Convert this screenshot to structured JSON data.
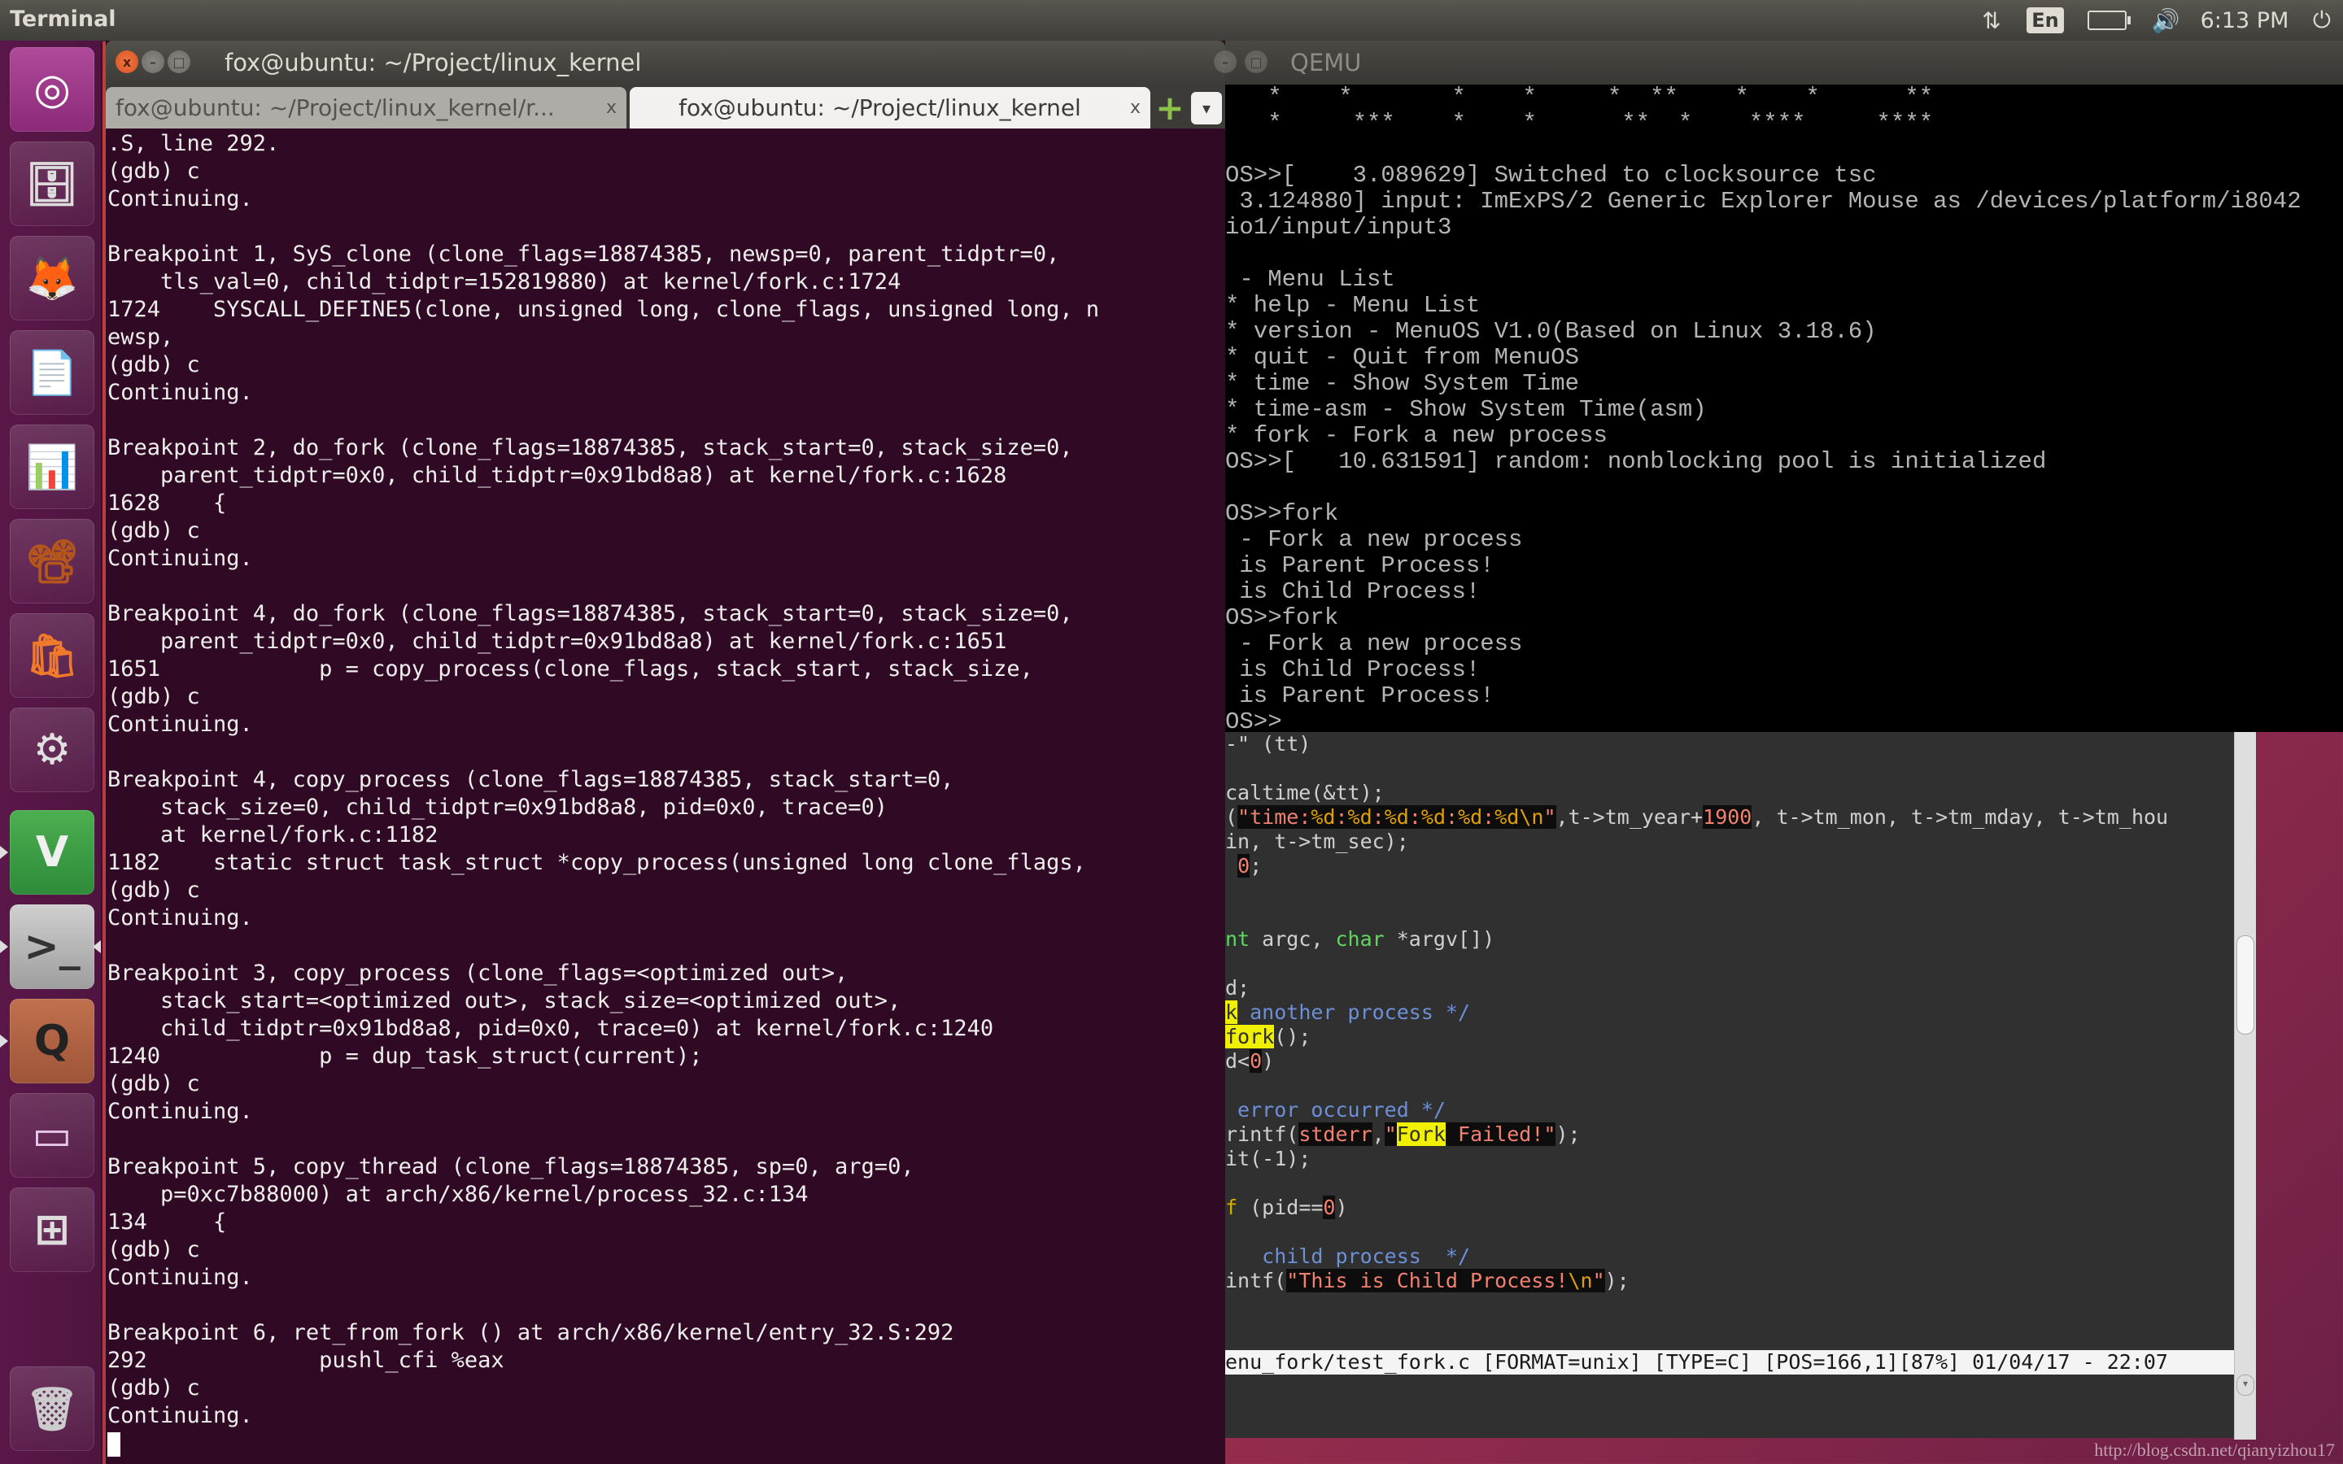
{
  "top_panel": {
    "app_title": "Terminal",
    "tray": {
      "network_icon": "network-transfer-icon",
      "keyboard_layout": "En",
      "battery_icon": "battery-charging-icon",
      "volume_icon": "volume-icon",
      "clock": "6:13 PM",
      "power_icon": "power-gear-icon"
    }
  },
  "launcher": {
    "items": [
      {
        "name": "dash-home",
        "icon": "ubuntu-logo-icon",
        "glyph": "◎"
      },
      {
        "name": "files",
        "icon": "file-cabinet-icon",
        "glyph": "🗄"
      },
      {
        "name": "firefox",
        "icon": "firefox-icon",
        "glyph": "🦊"
      },
      {
        "name": "libreoffice-writer",
        "icon": "writer-document-icon",
        "glyph": "📄"
      },
      {
        "name": "libreoffice-calc",
        "icon": "calc-spreadsheet-icon",
        "glyph": "📊"
      },
      {
        "name": "libreoffice-impress",
        "icon": "impress-presentation-icon",
        "glyph": "📽"
      },
      {
        "name": "software-center",
        "icon": "shopping-bag-icon",
        "glyph": "🛍"
      },
      {
        "name": "system-settings",
        "icon": "settings-wrench-icon",
        "glyph": "⚙"
      },
      {
        "name": "vim",
        "icon": "vim-icon",
        "glyph": "V"
      },
      {
        "name": "terminal",
        "icon": "terminal-icon",
        "glyph": ">_"
      },
      {
        "name": "qemu",
        "icon": "qemu-icon",
        "glyph": "Q"
      },
      {
        "name": "app-window",
        "icon": "window-icon",
        "glyph": "▭"
      },
      {
        "name": "workspace-switcher",
        "icon": "workspace-switcher-icon",
        "glyph": "⊞"
      },
      {
        "name": "trash",
        "icon": "trash-icon",
        "glyph": "🗑"
      }
    ]
  },
  "terminal": {
    "window_title": "fox@ubuntu: ~/Project/linux_kernel",
    "close_glyph": "x",
    "minimize_glyph": "–",
    "maximize_glyph": "□",
    "tabs": [
      {
        "label": "fox@ubuntu: ~/Project/linux_kernel/r...",
        "close": "x",
        "active": false
      },
      {
        "label": "fox@ubuntu: ~/Project/linux_kernel",
        "close": "x",
        "active": true
      }
    ],
    "new_tab_glyph": "+",
    "tab_menu_glyph": "▾",
    "lines": [
      ".S, line 292.",
      "(gdb) c",
      "Continuing.",
      "",
      "Breakpoint 1, SyS_clone (clone_flags=18874385, newsp=0, parent_tidptr=0,",
      "    tls_val=0, child_tidptr=152819880) at kernel/fork.c:1724",
      "1724\tSYSCALL_DEFINE5(clone, unsigned long, clone_flags, unsigned long, n",
      "ewsp,",
      "(gdb) c",
      "Continuing.",
      "",
      "Breakpoint 2, do_fork (clone_flags=18874385, stack_start=0, stack_size=0,",
      "    parent_tidptr=0x0, child_tidptr=0x91bd8a8) at kernel/fork.c:1628",
      "1628\t{",
      "(gdb) c",
      "Continuing.",
      "",
      "Breakpoint 4, do_fork (clone_flags=18874385, stack_start=0, stack_size=0,",
      "    parent_tidptr=0x0, child_tidptr=0x91bd8a8) at kernel/fork.c:1651",
      "1651\t\tp = copy_process(clone_flags, stack_start, stack_size,",
      "(gdb) c",
      "Continuing.",
      "",
      "Breakpoint 4, copy_process (clone_flags=18874385, stack_start=0,",
      "    stack_size=0, child_tidptr=0x91bd8a8, pid=0x0, trace=0)",
      "    at kernel/fork.c:1182",
      "1182\tstatic struct task_struct *copy_process(unsigned long clone_flags,",
      "(gdb) c",
      "Continuing.",
      "",
      "Breakpoint 3, copy_process (clone_flags=<optimized out>,",
      "    stack_start=<optimized out>, stack_size=<optimized out>,",
      "    child_tidptr=0x91bd8a8, pid=0x0, trace=0) at kernel/fork.c:1240",
      "1240\t\tp = dup_task_struct(current);",
      "(gdb) c",
      "Continuing.",
      "",
      "Breakpoint 5, copy_thread (clone_flags=18874385, sp=0, arg=0,",
      "    p=0xc7b88000) at arch/x86/kernel/process_32.c:134",
      "134\t{",
      "(gdb) c",
      "Continuing.",
      "",
      "Breakpoint 6, ret_from_fork () at arch/x86/kernel/entry_32.S:292",
      "292\t\tpushl_cfi %eax",
      "(gdb) c",
      "Continuing."
    ]
  },
  "qemu": {
    "window_title": "QEMU",
    "lines": [
      "   *    *       *    *     *  **    *    *      **",
      "   *     ***    *    *      **  *    ****     ****",
      "",
      "OS>>[    3.089629] Switched to clocksource tsc",
      " 3.124880] input: ImExPS/2 Generic Explorer Mouse as /devices/platform/i8042",
      "io1/input/input3",
      "",
      " - Menu List",
      "* help - Menu List",
      "* version - MenuOS V1.0(Based on Linux 3.18.6)",
      "* quit - Quit from MenuOS",
      "* time - Show System Time",
      "* time-asm - Show System Time(asm)",
      "* fork - Fork a new process",
      "OS>>[   10.631591] random: nonblocking pool is initialized",
      "",
      "OS>>fork",
      " - Fork a new process",
      " is Parent Process!",
      " is Child Process!",
      "OS>>fork",
      " - Fork a new process",
      " is Child Process!",
      " is Parent Process!",
      "OS>>"
    ]
  },
  "vim": {
    "lines": [
      [
        {
          "t": "-\" (tt)"
        }
      ],
      [
        {
          "t": ""
        }
      ],
      [
        {
          "t": "caltime(&tt);"
        }
      ],
      [
        {
          "t": "("
        },
        {
          "t": "\"time:",
          "c": "hl-str"
        },
        {
          "t": "%d",
          "c": "hl-fmt"
        },
        {
          "t": ":",
          "c": "hl-str"
        },
        {
          "t": "%d",
          "c": "hl-fmt"
        },
        {
          "t": ":",
          "c": "hl-str"
        },
        {
          "t": "%d",
          "c": "hl-fmt"
        },
        {
          "t": ":",
          "c": "hl-str"
        },
        {
          "t": "%d",
          "c": "hl-fmt"
        },
        {
          "t": ":",
          "c": "hl-str"
        },
        {
          "t": "%d",
          "c": "hl-fmt"
        },
        {
          "t": ":",
          "c": "hl-str"
        },
        {
          "t": "%d",
          "c": "hl-fmt"
        },
        {
          "t": "\\n",
          "c": "hl-fmt"
        },
        {
          "t": "\"",
          "c": "hl-str"
        },
        {
          "t": ",t->tm_year+"
        },
        {
          "t": "1900",
          "c": "hl-num"
        },
        {
          "t": ", t->tm_mon, t->tm_mday, t->tm_hou"
        }
      ],
      [
        {
          "t": "in, t->tm_sec);"
        }
      ],
      [
        {
          "t": " "
        },
        {
          "t": "0",
          "c": "hl-num"
        },
        {
          "t": ";"
        }
      ],
      [
        {
          "t": ""
        }
      ],
      [
        {
          "t": ""
        }
      ],
      [
        {
          "t": "nt",
          "c": "hl-type"
        },
        {
          "t": " argc, "
        },
        {
          "t": "char",
          "c": "hl-type"
        },
        {
          "t": " *argv[])"
        }
      ],
      [
        {
          "t": ""
        }
      ],
      [
        {
          "t": "d;"
        }
      ],
      [
        {
          "t": "k",
          "c": "hl-search"
        },
        {
          "t": " another process */",
          "c": "hl-cmt"
        }
      ],
      [
        {
          "t": "fork",
          "c": "hl-search"
        },
        {
          "t": "();"
        }
      ],
      [
        {
          "t": "d<"
        },
        {
          "t": "0",
          "c": "hl-num"
        },
        {
          "t": ")"
        }
      ],
      [
        {
          "t": ""
        }
      ],
      [
        {
          "t": " error occurred */",
          "c": "hl-cmt"
        }
      ],
      [
        {
          "t": "rintf("
        },
        {
          "t": "stderr",
          "c": "hl-str"
        },
        {
          "t": ","
        },
        {
          "t": "\"",
          "c": "hl-str"
        },
        {
          "t": "Fork",
          "c": "hl-search"
        },
        {
          "t": " Failed!\"",
          "c": "hl-str"
        },
        {
          "t": ");"
        }
      ],
      [
        {
          "t": "it(-1);"
        }
      ],
      [
        {
          "t": ""
        }
      ],
      [
        {
          "t": "f",
          "c": "hl-kw"
        },
        {
          "t": " (pid=="
        },
        {
          "t": "0",
          "c": "hl-num"
        },
        {
          "t": ")"
        }
      ],
      [
        {
          "t": ""
        }
      ],
      [
        {
          "t": "   child process  */",
          "c": "hl-cmt"
        }
      ],
      [
        {
          "t": "intf("
        },
        {
          "t": "\"This is Child Process!",
          "c": "hl-str"
        },
        {
          "t": "\\n",
          "c": "hl-fmt"
        },
        {
          "t": "\"",
          "c": "hl-str"
        },
        {
          "t": ");"
        }
      ]
    ],
    "status_line": "enu_fork/test_fork.c [FORMAT=unix] [TYPE=C] [POS=166,1][87%] 01/04/17 - 22:07",
    "scroll_position_percent": 87
  },
  "watermark": "http://blog.csdn.net/qianyizhou17"
}
